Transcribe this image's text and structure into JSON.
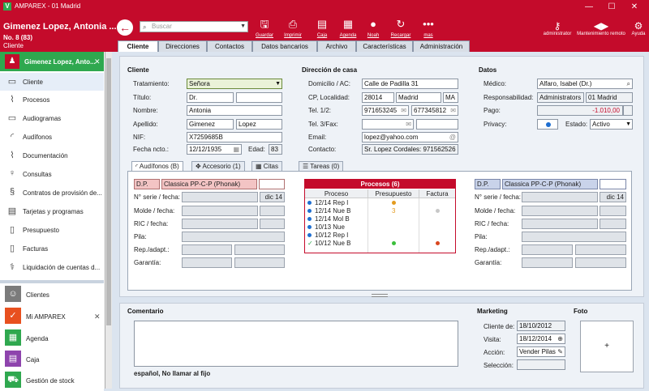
{
  "window": {
    "title": "AMPAREX - 01 Madrid",
    "logo": "V",
    "min": "—",
    "max": "☐",
    "close": "✕"
  },
  "header": {
    "patient_name": "Gimenez Lopez, Antonia ...",
    "patient_number": "No. 8 (83)",
    "type": "Cliente"
  },
  "search": {
    "placeholder": "Buscar"
  },
  "toolbar": [
    {
      "label": "Guardar",
      "icon": "save-icon"
    },
    {
      "label": "Imprimir",
      "icon": "print-icon"
    },
    {
      "label": "Caja",
      "icon": "cash-register-icon"
    },
    {
      "label": "Agenda",
      "icon": "calendar-icon"
    },
    {
      "label": "Noah",
      "icon": "noah-icon"
    },
    {
      "label": "Recargar",
      "icon": "reload-icon"
    },
    {
      "label": "mas",
      "icon": "more-icon"
    }
  ],
  "toolbar_right": [
    {
      "label": "administrator",
      "icon": "key-icon"
    },
    {
      "label": "Mantenimiento remoto",
      "icon": "remote-icon"
    },
    {
      "label": "Ayuda",
      "icon": "help-icon"
    }
  ],
  "tabs": [
    "Cliente",
    "Direcciones",
    "Contactos",
    "Datos bancarios",
    "Archivo",
    "Características",
    "Administración"
  ],
  "sidebar": {
    "head": "Gimenez Lopez, Anto...",
    "items": [
      {
        "label": "Cliente",
        "icon": "id-card-icon"
      },
      {
        "label": "Procesos",
        "icon": "paperclip-icon"
      },
      {
        "label": "Audiogramas",
        "icon": "audiogram-icon"
      },
      {
        "label": "Audífonos",
        "icon": "ear-icon"
      },
      {
        "label": "Documentación",
        "icon": "document-icon"
      },
      {
        "label": "Consultas",
        "icon": "microphone-icon"
      },
      {
        "label": "Contratos de provisión de...",
        "icon": "paragraph-icon"
      },
      {
        "label": "Tarjetas y programas",
        "icon": "card-icon"
      },
      {
        "label": "Presupuesto",
        "icon": "quote-icon"
      },
      {
        "label": "Facturas",
        "icon": "invoice-icon"
      },
      {
        "label": "Liquidación de cuentas d...",
        "icon": "caduceus-icon"
      }
    ],
    "nav": [
      {
        "label": "Clientes",
        "icon": "clients-icon",
        "color": "#7b7b7b"
      },
      {
        "label": "Mi AMPAREX",
        "icon": "clipboard-icon",
        "color": "#e8501f"
      },
      {
        "label": "Agenda",
        "icon": "calendar-icon",
        "color": "#2fa84f"
      },
      {
        "label": "Caja",
        "icon": "cash-register-icon",
        "color": "#8e44ad"
      },
      {
        "label": "Gestión de stock",
        "icon": "cart-icon",
        "color": "#2fa84f"
      }
    ]
  },
  "cliente": {
    "title": "Cliente",
    "tratamiento_label": "Tratamiento:",
    "tratamiento": "Señora",
    "titulo_label": "Título:",
    "titulo": "Dr.",
    "nombre_label": "Nombre:",
    "nombre": "Antonia",
    "apellido_label": "Apellido:",
    "apellido1": "Gimenez",
    "apellido2": "Lopez",
    "nif_label": "NIF:",
    "nif": "X7259685B",
    "fecha_label": "Fecha ncto.:",
    "fecha": "12/12/1935",
    "edad_label": "Edad:",
    "edad": "83"
  },
  "direccion": {
    "title": "Dirección de casa",
    "domicilio_label": "Domicilio / AC:",
    "domicilio": "Calle de Padilla 31",
    "cp_label": "CP, Localidad:",
    "cp": "28014",
    "localidad": "Madrid",
    "provincia": "MA",
    "tel12_label": "Tel. 1/2:",
    "tel1": "971653245",
    "tel2": "677345812",
    "tel3_label": "Tel. 3/Fax:",
    "email_label": "Email:",
    "email": "lopez@yahoo.com",
    "contacto_label": "Contacto:",
    "contacto": "Sr. Lopez Cordales: 971562526"
  },
  "datos": {
    "title": "Datos",
    "medico_label": "Médico:",
    "medico": "Alfaro, Isabel (Dr.)",
    "resp_label": "Responsabilidad:",
    "resp": "Administrators",
    "branch": "01 Madrid",
    "pago_label": "Pago:",
    "pago": "-1.010,00",
    "privacy_label": "Privacy:",
    "estado_label": "Estado:",
    "estado": "Activo"
  },
  "subtabs": [
    "Audífonos (B)",
    "Accesorio (1)",
    "Citas",
    "Tareas (0)"
  ],
  "aud_left": {
    "dp": "D.P.",
    "device": "Classica PP-C-P (Phonak)",
    "serie_label": "N° serie / fecha:",
    "serie_date": "dic 14",
    "molde_label": "Molde / fecha:",
    "ric_label": "RIC / fecha:",
    "pila_label": "Pila:",
    "rep_label": "Rep./adapt.:",
    "garantia_label": "Garantía:"
  },
  "aud_right": {
    "dp": "D.P.",
    "device": "Classica PP-C-P (Phonak)",
    "serie_label": "N° serie / fecha:",
    "serie_date": "dic 14",
    "molde_label": "Molde / fecha:",
    "ric_label": "RIC / fecha:",
    "pila_label": "Pila:",
    "rep_label": "Rep./adapt.:",
    "garantia_label": "Garantía:"
  },
  "procesos": {
    "title": "Procesos (6)",
    "headers": [
      "Proceso",
      "Presupuesto",
      "Factura"
    ],
    "rows": [
      {
        "text": "12/14 Rep I",
        "mark": "dot",
        "pres": "orange",
        "fac": ""
      },
      {
        "text": "12/14 Nue B",
        "mark": "dot",
        "pres": "3",
        "fac": "gray"
      },
      {
        "text": "12/14 Mol B",
        "mark": "dot",
        "pres": "",
        "fac": ""
      },
      {
        "text": "10/13 Nue",
        "mark": "dot",
        "pres": "",
        "fac": ""
      },
      {
        "text": "10/12 Rep I",
        "mark": "dot",
        "pres": "",
        "fac": ""
      },
      {
        "text": "10/12 Nue B",
        "mark": "check",
        "pres": "green",
        "fac": "red"
      }
    ]
  },
  "comentario": {
    "title": "Comentario",
    "text": "español, No llamar al fijo"
  },
  "marketing": {
    "title": "Marketing",
    "cliente_de_label": "Cliente de:",
    "cliente_de": "18/10/2012",
    "visita_label": "Visita:",
    "visita": "18/12/2014",
    "accion_label": "Acción:",
    "accion": "Vender Pilas",
    "seleccion_label": "Selección:"
  },
  "foto": {
    "title": "Foto",
    "add": "+"
  }
}
